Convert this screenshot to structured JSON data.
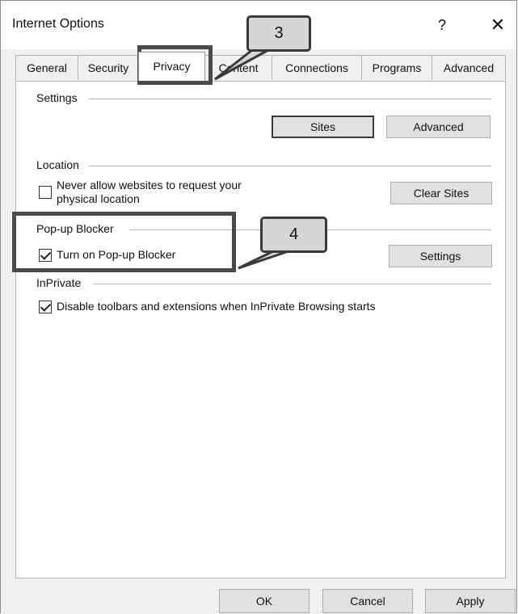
{
  "window": {
    "title": "Internet Options",
    "help_label": "?",
    "close_label": "✕"
  },
  "tabs": [
    {
      "label": "General",
      "selected": false
    },
    {
      "label": "Security",
      "selected": false
    },
    {
      "label": "Privacy",
      "selected": true
    },
    {
      "label": "Content",
      "selected": false
    },
    {
      "label": "Connections",
      "selected": false
    },
    {
      "label": "Programs",
      "selected": false
    },
    {
      "label": "Advanced",
      "selected": false
    }
  ],
  "settings": {
    "heading": "Settings",
    "sites_button": "Sites",
    "advanced_button": "Advanced"
  },
  "location": {
    "heading": "Location",
    "never_allow_line1": "Never allow websites to request your",
    "never_allow_line2": "physical location",
    "never_allow_checked": false,
    "clear_sites_button": "Clear Sites"
  },
  "popup": {
    "heading": "Pop-up Blocker",
    "turn_on_label": "Turn on Pop-up Blocker",
    "turn_on_checked": true,
    "settings_button": "Settings"
  },
  "inprivate": {
    "heading": "InPrivate",
    "disable_label": "Disable toolbars and extensions when InPrivate Browsing starts",
    "disable_checked": true
  },
  "footer": {
    "ok_label": "OK",
    "cancel_label": "Cancel",
    "apply_label": "Apply"
  },
  "callouts": {
    "step3": "3",
    "step4": "4"
  },
  "colors": {
    "dialog_bg": "#f0f0f0",
    "panel_bg": "#ffffff",
    "callout_border": "#4a4a4a",
    "callout_fill": "#d6d6d6"
  }
}
